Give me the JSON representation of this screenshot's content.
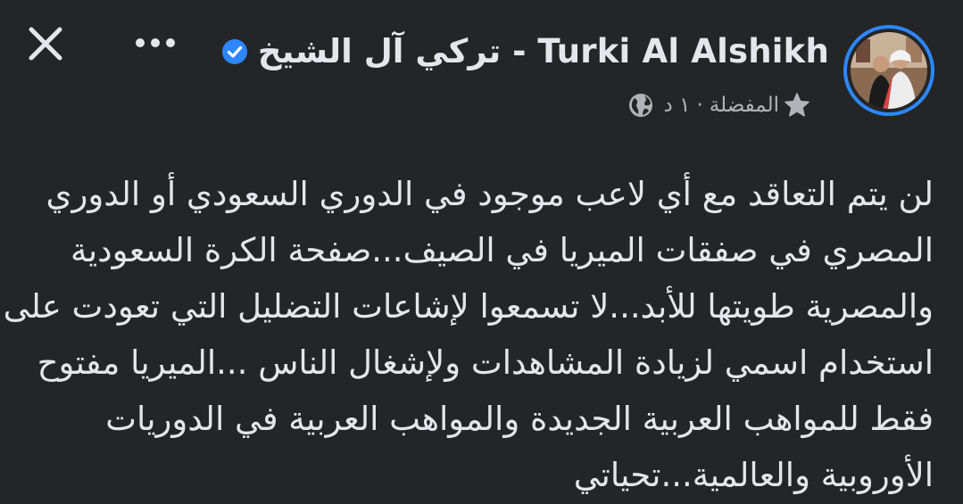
{
  "header": {
    "close_icon": "close-icon",
    "more_icon": "more-horizontal-icon",
    "author_name": "تركي آل الشيخ - Turki Al Alshikh",
    "verified_icon": "verified-badge-icon",
    "verified_color": "#2d88ff",
    "avatar_ring_color": "#2d88ff"
  },
  "meta": {
    "favorites_label": "المفضلة",
    "separator": "·",
    "time_label": "١ د",
    "audience_icon": "globe-icon",
    "favorites_icon": "star-icon"
  },
  "post": {
    "lines": [
      "لن يتم التعاقد مع أي لاعب موجود في الدوري السعودي أو الدوري",
      "المصري في صفقات الميريا في الصيف...صفحة الكرة السعودية",
      "والمصرية طويتها للأبد...لا تسمعوا لإشاعات التضليل التي تعودت على",
      "استخدام اسمي لزيادة المشاهدات ولإشغال الناس ...الميريا مفتوح",
      "فقط للمواهب العربية الجديدة والمواهب العربية في الدوريات",
      "الأوروبية والعالمية...تحياتي"
    ]
  },
  "colors": {
    "background": "#242526",
    "primary_text": "#e4e6eb",
    "secondary_text": "#b0b3b8"
  }
}
